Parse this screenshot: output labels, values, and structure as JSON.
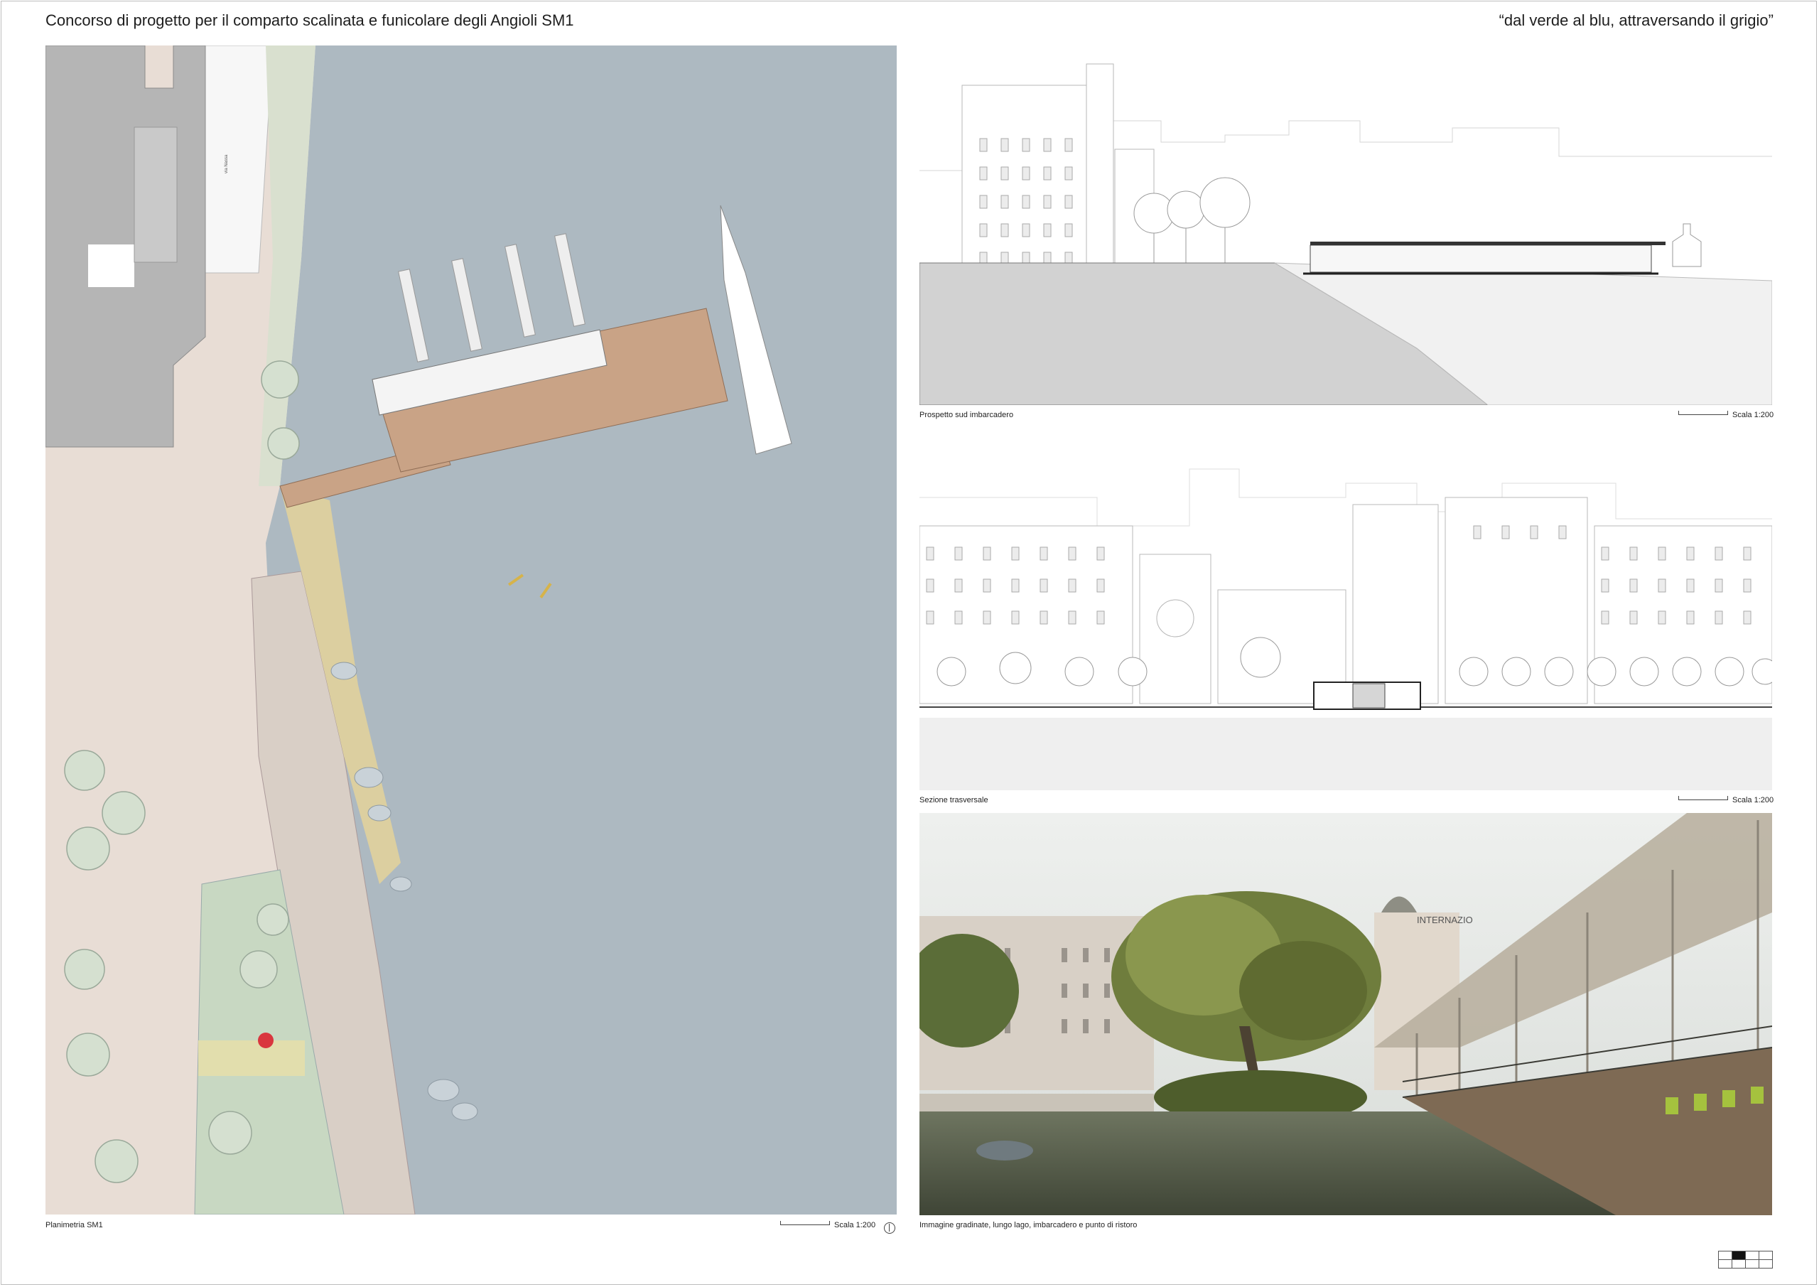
{
  "header": {
    "title": "Concorso di progetto per il comparto scalinata e funicolare degli Angioli  SM1",
    "motto": "“dal verde al blu, attraversando il grigio”"
  },
  "plan": {
    "caption": "Planimetria SM1",
    "scale": "Scala 1:200",
    "street_label": "via Nassa"
  },
  "elevation": {
    "caption": "Prospetto sud imbarcadero",
    "scale": "Scala 1:200"
  },
  "section": {
    "caption": "Sezione trasversale",
    "scale": "Scala 1:200"
  },
  "render": {
    "caption": "Immagine gradinate, lungo lago, imbarcadero e punto di ristoro",
    "hotel_sign": "INTERNAZIO"
  },
  "colors": {
    "lake": "#adb9c1",
    "pier_deck": "#c9a386",
    "pavement": "#e8ddd5",
    "green_park": "#c8d8c2",
    "gravel_yellow": "#dccfa0",
    "buildings": "#b5b5b5"
  },
  "sheet_index": {
    "active_cell": 2,
    "cells": 8
  }
}
